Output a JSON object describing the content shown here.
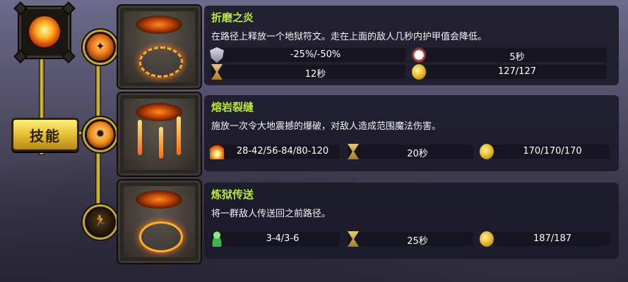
{
  "skill_tree_label": "技能",
  "skills": [
    {
      "title": "折磨之炎",
      "description": "在路径上释放一个地狱符文。走在上面的敌人几秒内护甲值会降低。",
      "stats": [
        {
          "icon": "armor-shield-icon",
          "value": "-25%/-50%"
        },
        {
          "icon": "stopwatch-icon",
          "value": "5秒"
        },
        {
          "icon": "hourglass-icon",
          "value": "12秒"
        },
        {
          "icon": "gold-coins-icon",
          "value": "127/127"
        }
      ]
    },
    {
      "title": "熔岩裂缝",
      "description": "施放一次令大地震撼的爆破，对敌人造成范围魔法伤害。",
      "stats": [
        {
          "icon": "fire-damage-icon",
          "value": "28-42/56-84/80-120"
        },
        {
          "icon": "hourglass-icon",
          "value": "20秒"
        },
        {
          "icon": "gold-coins-icon",
          "value": "170/170/170"
        }
      ]
    },
    {
      "title": "炼狱传送",
      "description": "将一群敌人传送回之前路径。",
      "stats": [
        {
          "icon": "enemy-pawn-icon",
          "value": "3-4/3-6"
        },
        {
          "icon": "hourglass-icon",
          "value": "25秒"
        },
        {
          "icon": "gold-coins-icon",
          "value": "187/187"
        }
      ]
    }
  ],
  "colors": {
    "title_green": "#b9ea3a",
    "gold_frame": "#e2b92b",
    "panel_bg": "#1c1b2a"
  }
}
